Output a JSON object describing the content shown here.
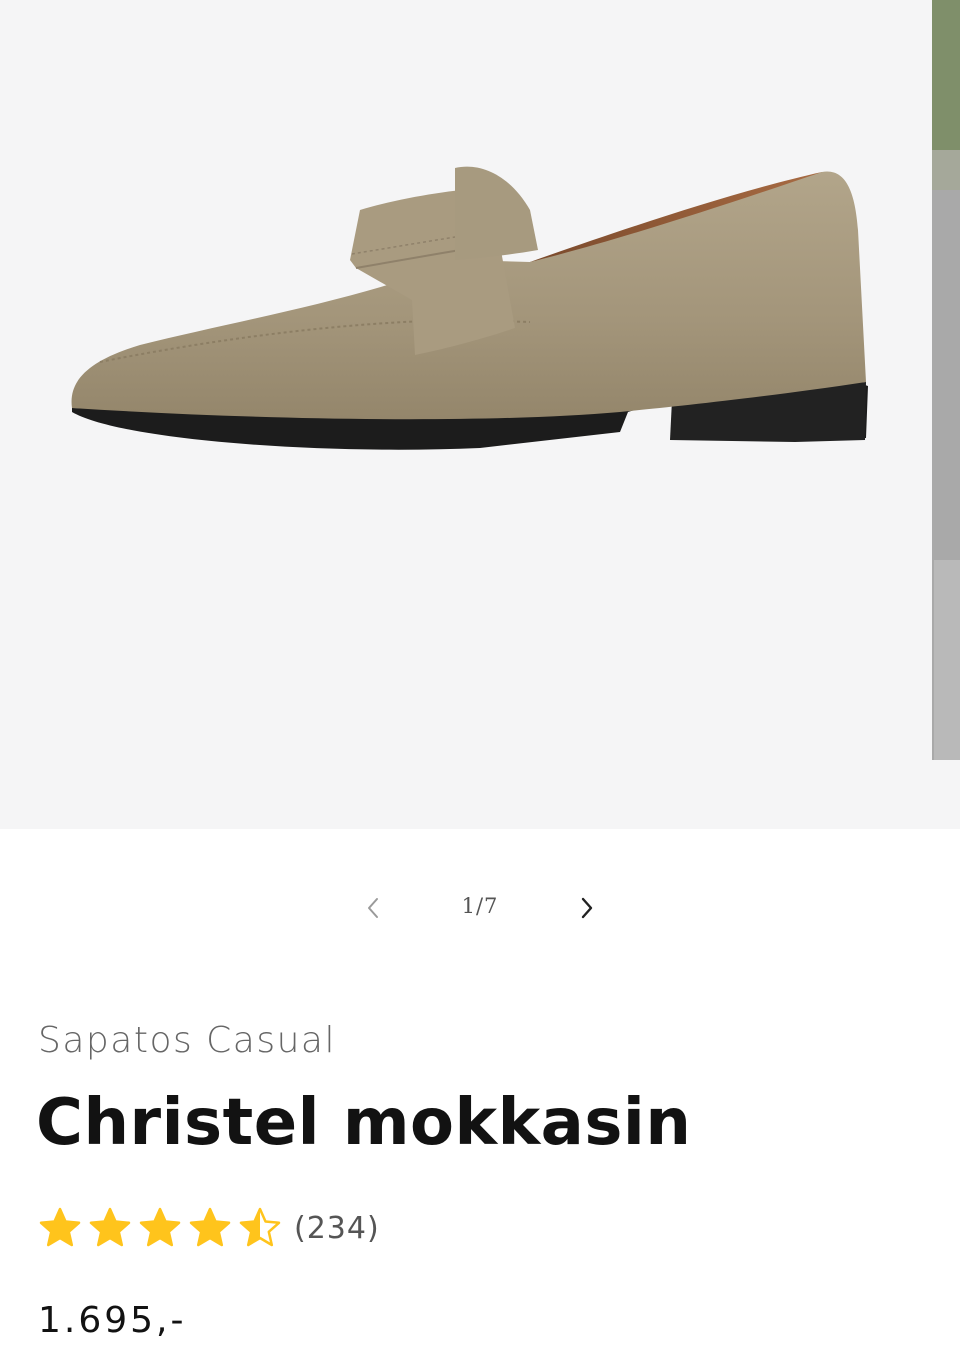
{
  "gallery": {
    "current_slide": 1,
    "total_slides": 7,
    "counter_label": "1/7",
    "main_image": "beige-suede-loafer-product-photo",
    "next_image": "outdoor-lifestyle-photo-partial",
    "prev_icon": "chevron-left-icon",
    "next_icon": "chevron-right-icon"
  },
  "product": {
    "vendor": "Sapatos Casual",
    "title": "Christel mokkasin",
    "rating": 4.5,
    "rating_max": 5,
    "rating_count": "(234)",
    "price": "1.695,-"
  },
  "colors": {
    "star": "#ffc41c",
    "gallery_bg": "#f5f5f6",
    "shoe_upper": "#a89a7f",
    "shoe_sole": "#1c1c1c"
  }
}
